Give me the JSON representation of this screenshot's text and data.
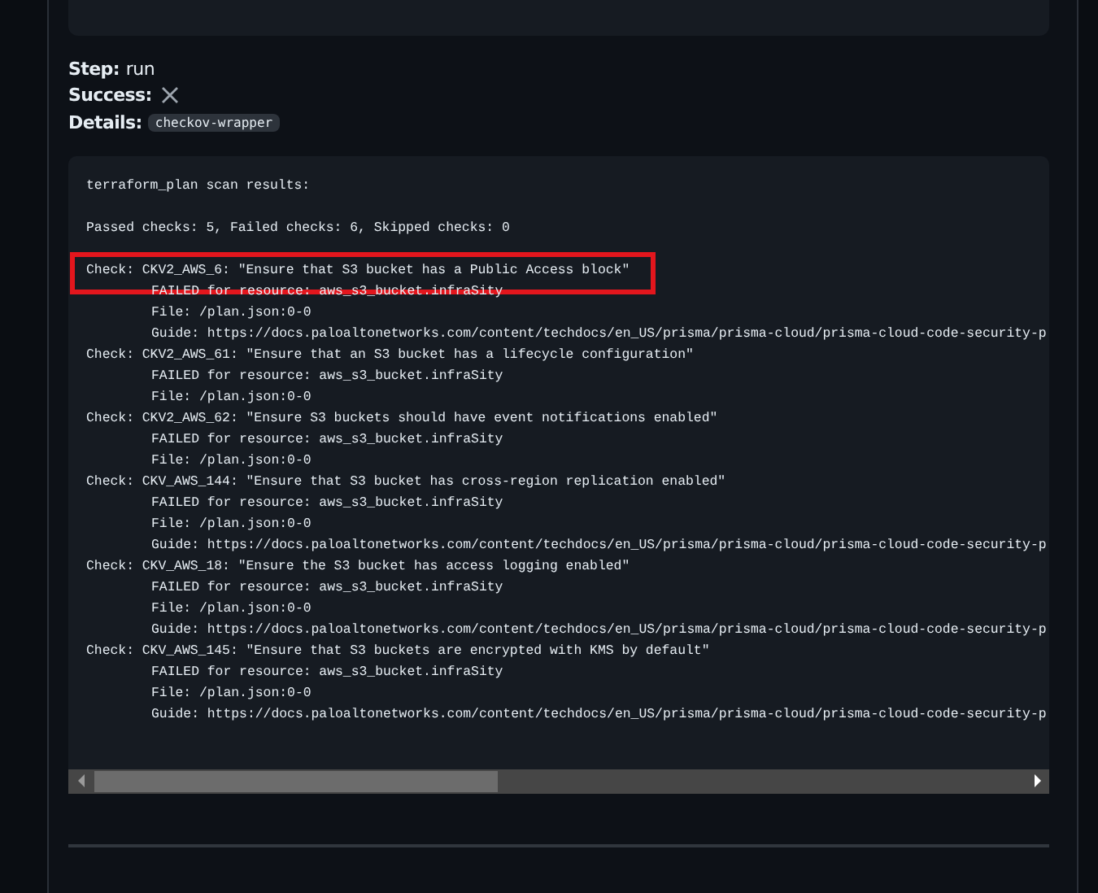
{
  "step": {
    "label": "Step:",
    "value": "run"
  },
  "success": {
    "label": "Success:",
    "value": false
  },
  "details": {
    "label": "Details:",
    "tag": "checkov-wrapper"
  },
  "output": {
    "lines": [
      {
        "kind": "title",
        "text": "terraform_plan scan results:",
        "highlighted": false
      },
      {
        "kind": "summary",
        "text": "Passed checks: 5, Failed checks: 6, Skipped checks: 0",
        "highlighted": false
      },
      {
        "kind": "check",
        "text": "Check: CKV2_AWS_6: \"Ensure that S3 bucket has a Public Access block\"",
        "highlighted": true
      },
      {
        "kind": "detail",
        "text": "FAILED for resource: aws_s3_bucket.infraSity",
        "highlighted": false
      },
      {
        "kind": "detail",
        "text": "File: /plan.json:0-0",
        "highlighted": false
      },
      {
        "kind": "detail",
        "text": "Guide: https://docs.paloaltonetworks.com/content/techdocs/en_US/prisma/prisma-cloud/prisma-cloud-code-security-p",
        "highlighted": false
      },
      {
        "kind": "check",
        "text": "Check: CKV2_AWS_61: \"Ensure that an S3 bucket has a lifecycle configuration\"",
        "highlighted": false
      },
      {
        "kind": "detail",
        "text": "FAILED for resource: aws_s3_bucket.infraSity",
        "highlighted": false
      },
      {
        "kind": "detail",
        "text": "File: /plan.json:0-0",
        "highlighted": false
      },
      {
        "kind": "check",
        "text": "Check: CKV2_AWS_62: \"Ensure S3 buckets should have event notifications enabled\"",
        "highlighted": false
      },
      {
        "kind": "detail",
        "text": "FAILED for resource: aws_s3_bucket.infraSity",
        "highlighted": false
      },
      {
        "kind": "detail",
        "text": "File: /plan.json:0-0",
        "highlighted": false
      },
      {
        "kind": "check",
        "text": "Check: CKV_AWS_144: \"Ensure that S3 bucket has cross-region replication enabled\"",
        "highlighted": false
      },
      {
        "kind": "detail",
        "text": "FAILED for resource: aws_s3_bucket.infraSity",
        "highlighted": false
      },
      {
        "kind": "detail",
        "text": "File: /plan.json:0-0",
        "highlighted": false
      },
      {
        "kind": "detail",
        "text": "Guide: https://docs.paloaltonetworks.com/content/techdocs/en_US/prisma/prisma-cloud/prisma-cloud-code-security-p",
        "highlighted": false
      },
      {
        "kind": "check",
        "text": "Check: CKV_AWS_18: \"Ensure the S3 bucket has access logging enabled\"",
        "highlighted": false
      },
      {
        "kind": "detail",
        "text": "FAILED for resource: aws_s3_bucket.infraSity",
        "highlighted": false
      },
      {
        "kind": "detail",
        "text": "File: /plan.json:0-0",
        "highlighted": false
      },
      {
        "kind": "detail",
        "text": "Guide: https://docs.paloaltonetworks.com/content/techdocs/en_US/prisma/prisma-cloud/prisma-cloud-code-security-p",
        "highlighted": false
      },
      {
        "kind": "check",
        "text": "Check: CKV_AWS_145: \"Ensure that S3 buckets are encrypted with KMS by default\"",
        "highlighted": false
      },
      {
        "kind": "detail",
        "text": "FAILED for resource: aws_s3_bucket.infraSity",
        "highlighted": false
      },
      {
        "kind": "detail",
        "text": "File: /plan.json:0-0",
        "highlighted": false
      },
      {
        "kind": "detail",
        "text": "Guide: https://docs.paloaltonetworks.com/content/techdocs/en_US/prisma/prisma-cloud/prisma-cloud-code-security-p",
        "highlighted": false
      }
    ]
  }
}
